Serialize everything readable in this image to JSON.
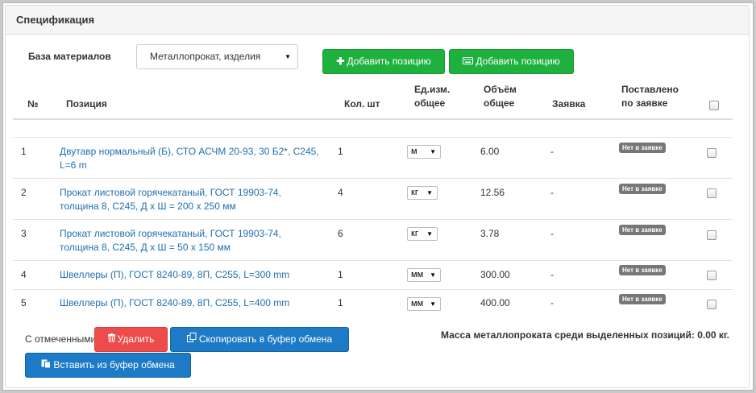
{
  "panel": {
    "title": "Спецификация"
  },
  "base": {
    "label": "База материалов",
    "selected": "Металлопрокат, изделия"
  },
  "toolbar": {
    "add_label": "Добавить позицию",
    "add_icon": "plus-icon",
    "add_keyboard_label": "Добавить позицию",
    "add_keyboard_icon": "keyboard-icon"
  },
  "table": {
    "headers": {
      "num": "№",
      "position": "Позиция",
      "qty": "Кол. шт",
      "unit_line1": "Ед.изм.",
      "unit_line2": "общее",
      "vol_line1": "Объём",
      "vol_line2": "общее",
      "request": "Заявка",
      "delivered_line1": "Поставлено",
      "delivered_line2": "по заявке"
    },
    "rows": [
      {
        "num": "1",
        "name_line1": "Двутавр нормальный (Б), СТО АСЧМ 20-93, 30 Б2*, С245,",
        "name_line2": "L=6 m",
        "qty": "1",
        "unit": "м",
        "volume": "6.00",
        "request": "-",
        "status": "Нет в заявке"
      },
      {
        "num": "2",
        "name_line1": "Прокат листовой горячекатаный, ГОСТ 19903-74,",
        "name_line2": "толщина 8, С245, Д x Ш = 200 x 250 мм",
        "qty": "4",
        "unit": "кг",
        "volume": "12.56",
        "request": "-",
        "status": "Нет в заявке"
      },
      {
        "num": "3",
        "name_line1": "Прокат листовой горячекатаный, ГОСТ 19903-74,",
        "name_line2": "толщина 8, С245, Д x Ш = 50 x 150 мм",
        "qty": "6",
        "unit": "кг",
        "volume": "3.78",
        "request": "-",
        "status": "Нет в заявке"
      },
      {
        "num": "4",
        "name_line1": "Швеллеры (П), ГОСТ 8240-89, 8П, С255, L=300 mm",
        "name_line2": "",
        "qty": "1",
        "unit": "мм",
        "volume": "300.00",
        "request": "-",
        "status": "Нет в заявке"
      },
      {
        "num": "5",
        "name_line1": "Швеллеры (П), ГОСТ 8240-89, 8П, С255, L=400 mm",
        "name_line2": "",
        "qty": "1",
        "unit": "мм",
        "volume": "400.00",
        "request": "-",
        "status": "Нет в заявке"
      }
    ]
  },
  "footer": {
    "selected_label": "С отмеченными",
    "delete_label": "Удалить",
    "delete_icon": "trash-icon",
    "copy_label": "Скопировать в буфер обмена",
    "copy_icon": "copy-icon",
    "paste_label": "Вставить из буфер обмена",
    "paste_icon": "paste-icon",
    "mass_text": "Масса металлопроката среди выделенных позиций: 0.00 кг."
  },
  "colors": {
    "accent_green": "#1fb13e",
    "accent_blue": "#1d7ac6",
    "danger_red": "#ee4b4b",
    "link": "#1f6fb2",
    "badge": "#777777"
  }
}
